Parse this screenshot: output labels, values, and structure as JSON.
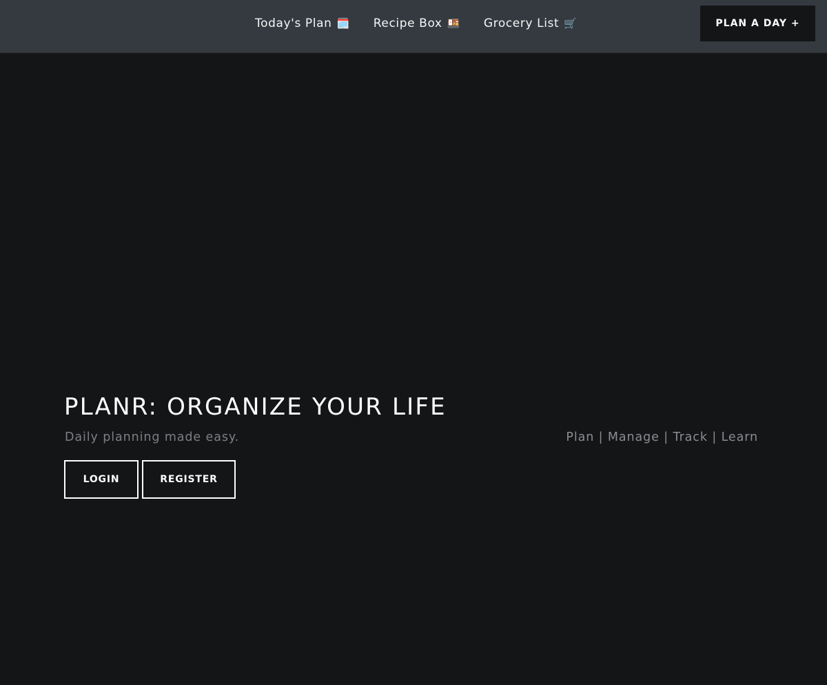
{
  "nav": {
    "links": [
      {
        "label": "Today's Plan",
        "icon": "🗓️",
        "icon_name": "calendar-icon"
      },
      {
        "label": "Recipe Box",
        "icon": "🍱",
        "icon_name": "bento-box-icon"
      },
      {
        "label": "Grocery List",
        "icon": "🛒",
        "icon_name": "shopping-cart-icon"
      }
    ],
    "cta_label": "PLAN A DAY +"
  },
  "hero": {
    "title": "PLANR: ORGANIZE YOUR LIFE",
    "subtitle": "Daily planning made easy.",
    "tagline": "Plan | Manage | Track | Learn",
    "login_label": "LOGIN",
    "register_label": "REGISTER"
  },
  "colors": {
    "page_background": "#141517",
    "navbar_background": "#343a40",
    "text_primary": "#ffffff",
    "text_muted": "#7c7f83"
  }
}
